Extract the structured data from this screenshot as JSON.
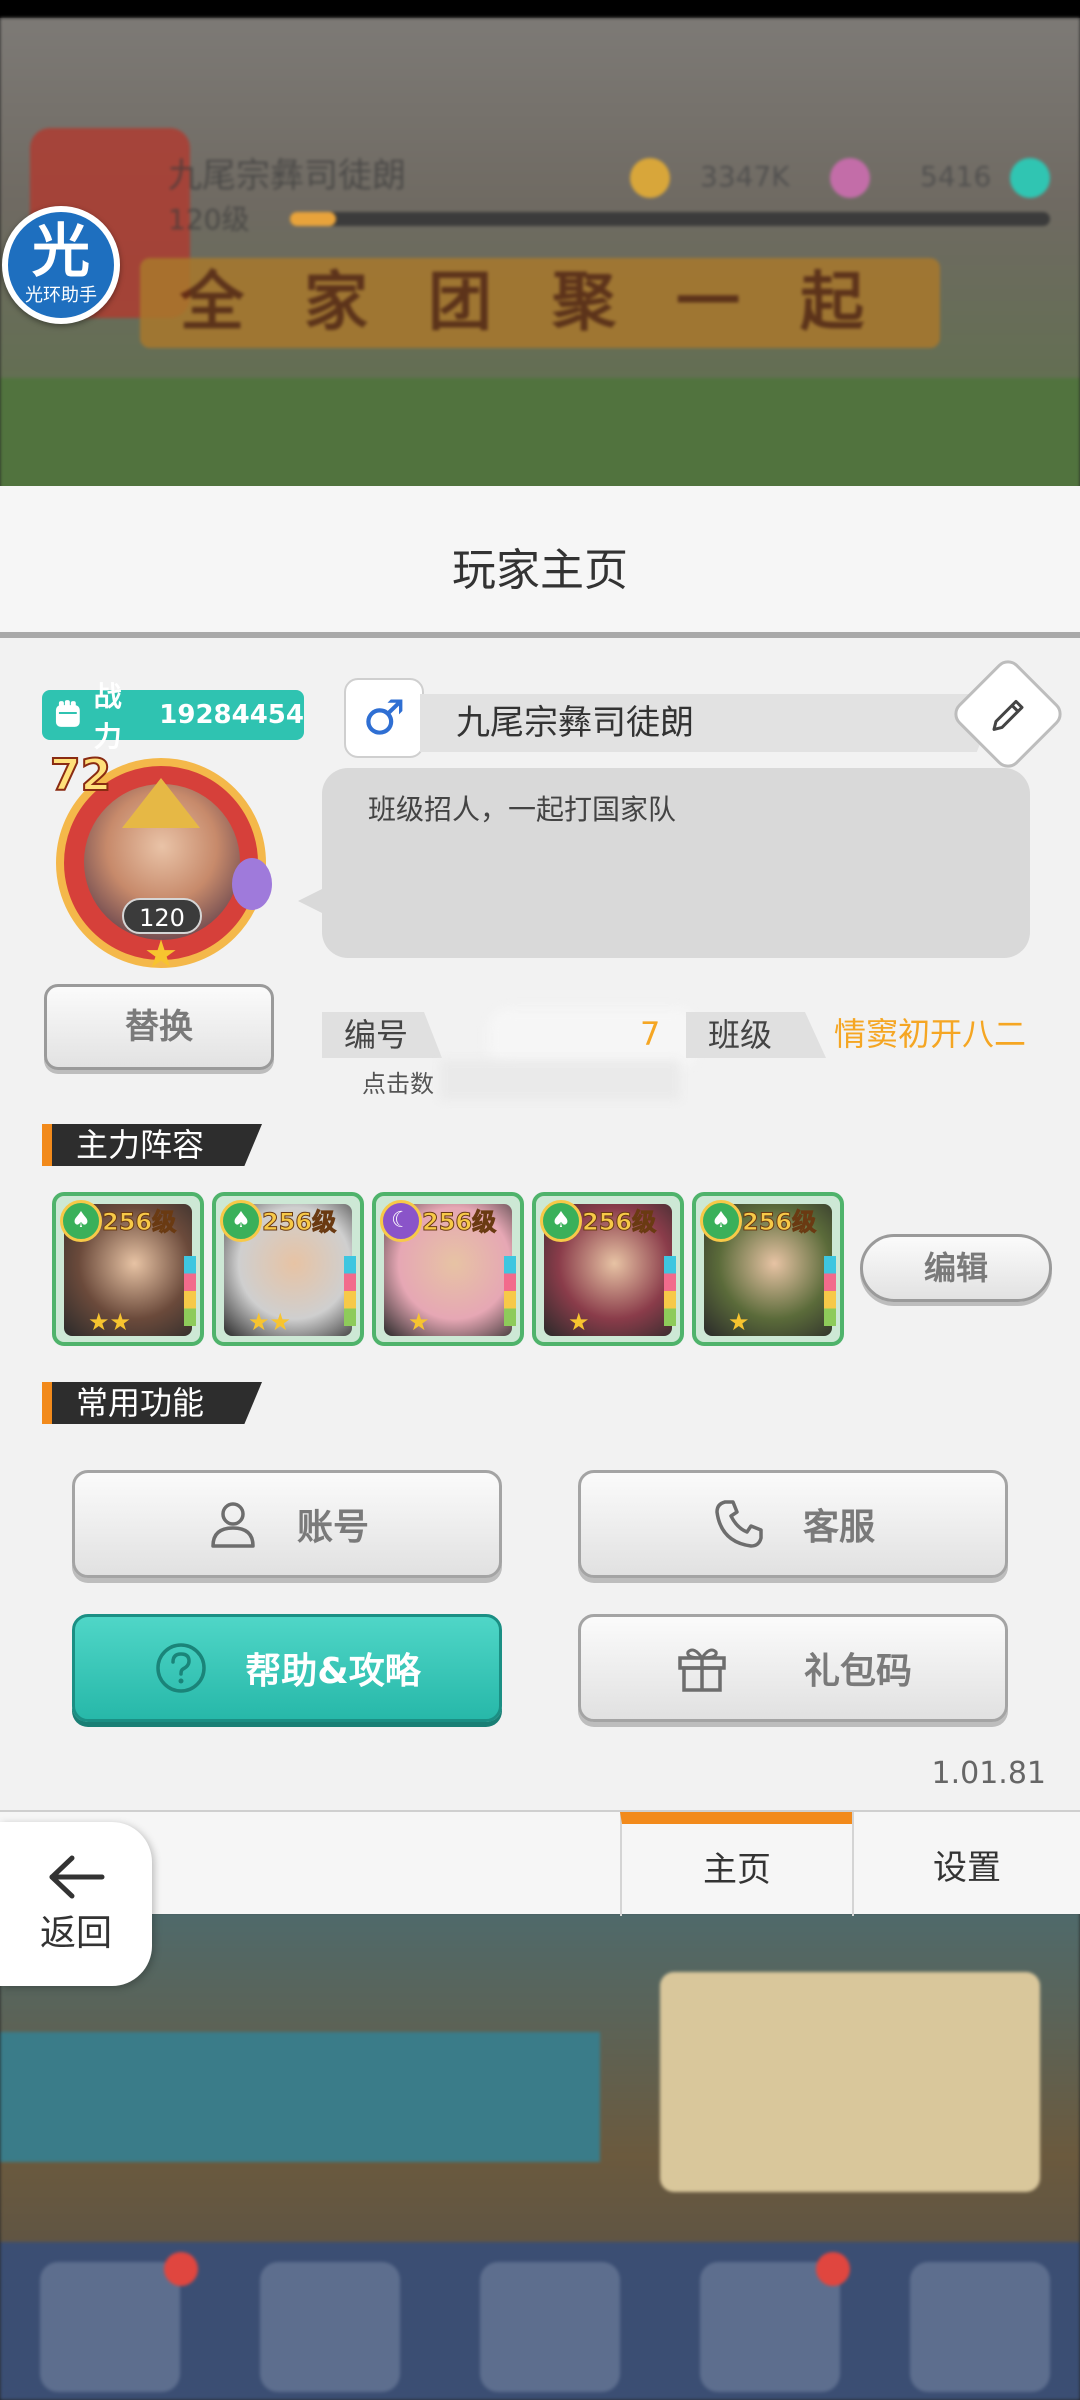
{
  "dialog": {
    "title": "玩家主页",
    "power": {
      "label": "战力",
      "value": "19284454"
    },
    "avatar": {
      "vip": "72",
      "level": "120"
    },
    "replace_button": "替换",
    "gender_symbol": "♂",
    "player_name": "九尾宗彝司徒朗",
    "signature": "班级招人，一起打国家队",
    "id_label": "编号",
    "id_value_visible": "7",
    "class_label": "班级",
    "class_value": "情窦初开八二",
    "copy_hint": "点击数",
    "lineup_title": "主力阵容",
    "heroes": [
      {
        "level": "256级",
        "stars": "★★",
        "art_color": "#6b4a3b",
        "camp_color": "#3ab05a",
        "camp_symbol": "♠"
      },
      {
        "level": "256级",
        "stars": "★★",
        "art_color": "#cfcfcf",
        "camp_color": "#3ab05a",
        "camp_symbol": "♠"
      },
      {
        "level": "256级",
        "stars": "★",
        "art_color": "#e6a7b4",
        "camp_color": "#8a54c9",
        "camp_symbol": "☾"
      },
      {
        "level": "256级",
        "stars": "★",
        "art_color": "#8a3c4a",
        "camp_color": "#3ab05a",
        "camp_symbol": "♠"
      },
      {
        "level": "256级",
        "stars": "★",
        "art_color": "#5b6b3a",
        "camp_color": "#3ab05a",
        "camp_symbol": "♠"
      }
    ],
    "edit_lineup_button": "编辑",
    "functions_title": "常用功能",
    "buttons": {
      "account": "账号",
      "service": "客服",
      "help": "帮助&攻略",
      "gift": "礼包码"
    },
    "version": "1.01.81",
    "tabs": {
      "home": "主页",
      "settings": "设置"
    }
  },
  "back_button": "返回",
  "helper": {
    "glyph": "光",
    "label": "光环助手"
  },
  "background": {
    "player_name": "九尾宗彝司徒朗",
    "level": "120级",
    "coins": "3347K",
    "gems": "5416",
    "banner": "全家团聚一起玩"
  },
  "colors": {
    "accent_teal": "#2fc3b1",
    "accent_orange": "#f28a1b",
    "highlight_text": "#f5a623"
  }
}
